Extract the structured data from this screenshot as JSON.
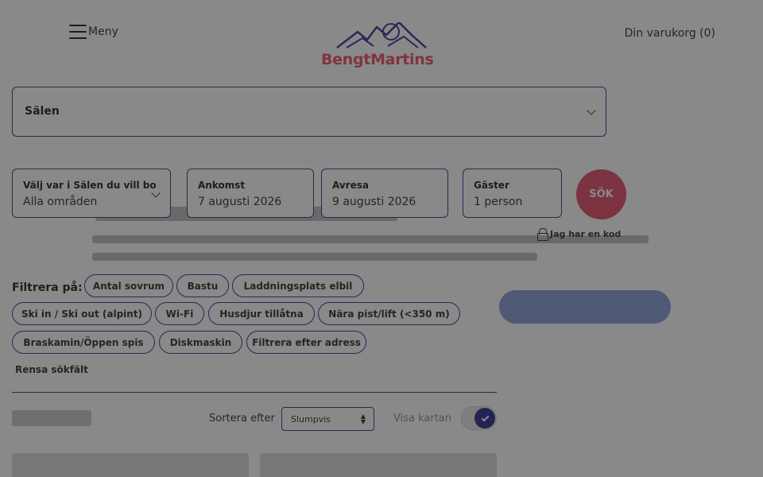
{
  "header": {
    "menu_label": "Meny",
    "brand": "BengtMartins",
    "cart_label": "Din varukorg (0)"
  },
  "destination": {
    "value": "Sälen"
  },
  "search": {
    "area_label": "Välj var i Sälen du vill bo",
    "area_value": "Alla områden",
    "arrival_label": "Ankomst",
    "arrival_value": "7 augusti 2026",
    "departure_label": "Avresa",
    "departure_value": "9 augusti 2026",
    "guests_label": "Gäster",
    "guests_value": "1 person",
    "search_button": "SÖK",
    "code_link": "Jag har en kod"
  },
  "filters": {
    "label": "Filtrera på:",
    "chips": [
      "Antal sovrum",
      "Bastu",
      "Laddningsplats elbil",
      "Ski in / Ski out (alpint)",
      "Wi-Fi",
      "Husdjur tillåtna",
      "Nära pist/lift (<350 m)",
      "Braskamin/Öppen spis",
      "Diskmaskin",
      "Filtrera efter adress"
    ],
    "clear_label": "Rensa sökfält"
  },
  "results": {
    "sort_label": "Sortera efter",
    "sort_value": "Slumpvis",
    "map_label": "Visa kartan",
    "map_toggle_on": true
  },
  "colors": {
    "brand_pink": "#e0405d",
    "border_navy": "#2a2a8c",
    "toggle_navy": "#1e1e8c"
  }
}
